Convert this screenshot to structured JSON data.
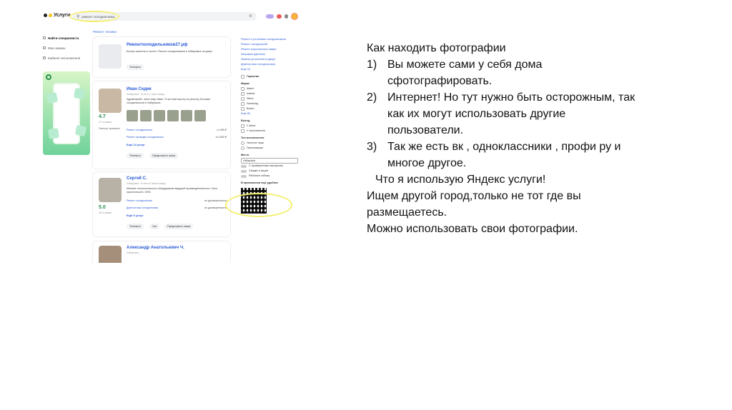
{
  "screenshot": {
    "brand": "Услуги",
    "search_value": "ремонт холодильника",
    "breadcrumb": "Ремонт техники",
    "sidebar": [
      {
        "label": "Найти специалиста",
        "active": true
      },
      {
        "label": "Мои заказы",
        "active": false
      },
      {
        "label": "Кабинет исполнителя",
        "active": false
      }
    ],
    "cards": [
      {
        "name": "Ремонтхолодильников27.рф",
        "desc": "Быстро качество и честно. Ремонт холодильников в Хабаровске на дому!",
        "buttons": [
          "Телефон"
        ]
      },
      {
        "name": "Иван Седик",
        "sub": "Хабаровск · В сети 2 часа назад",
        "desc": "Здравствуйте, меня зовут Иван. Я частный мастер по ремонту бытовых холодильников в Хабаровске.",
        "rating": "4.7",
        "reviews": "12 отзывов",
        "check": "Паспорт проверен",
        "prices": [
          {
            "service": "Ремонт холодильника",
            "price": "от 300 ₽"
          },
          {
            "service": "Ремонт проводки холодильника",
            "price": "от 1000 ₽"
          }
        ],
        "more_link": "Ещё 14 услуг",
        "buttons": [
          "Телефон",
          "Предложить заказ"
        ]
      },
      {
        "name": "Сергей С.",
        "sub": "Хабаровск · В сети 5 часов назад",
        "desc": "Меньше технологического оборудования ведущей производительности. Опыт практической с 2005.",
        "rating": "5.0",
        "reviews": "28 отзывов",
        "prices": [
          {
            "service": "Ремонт холодильника",
            "price": "по договоренности"
          },
          {
            "service": "Диагностика холодильника",
            "price": "по договоренности"
          }
        ],
        "more_link": "Ещё 9 услуг",
        "buttons": [
          "Телефон",
          "Чат",
          "Предложить заказ"
        ]
      },
      {
        "name": "Александр Анатольевич Ч.",
        "sub": "Хабаровск"
      }
    ],
    "filters": {
      "links": [
        "Ремонт и установка холодильников",
        "Ремонт холодильной",
        "Ремонт морозильных камер",
        "Заправка фреоном",
        "Замена уплотнителя двери",
        "Диагностика холодильника",
        "Ещё 10"
      ],
      "guarantee": "Гарантия",
      "brand_header": "Марка",
      "brands": [
        "Atlant",
        "Indesit",
        "Stinol",
        "Samsung",
        "Bosch"
      ],
      "brand_more": "Ещё 60",
      "visit_header": "Выезд",
      "visit": [
        "У меня",
        "У исполнителя"
      ],
      "type_header": "Тип исполнителя",
      "types": [
        "Частное лицо",
        "Организация"
      ],
      "place_header": "Место",
      "city_value": "Хабаровск",
      "toggles": [
        "С проверенным паспортом",
        "Скидки и акции",
        "Работает сейчас"
      ],
      "app_note": "В приложении ещё удобнее"
    }
  },
  "slide": {
    "heading": "Как находить фотографии",
    "items": [
      {
        "num": "1)",
        "lines": [
          "Вы можете сами у себя дома",
          "сфотографировать."
        ]
      },
      {
        "num": "2)",
        "lines": [
          "Интернет! Но тут нужно быть осторожным, так",
          "как их могут использовать другие",
          "пользователи."
        ]
      },
      {
        "num": "3)",
        "lines": [
          "Так же есть вк , одноклассники , профи ру и",
          "многое другое."
        ]
      }
    ],
    "line4": "Что я использую Яндекс услуги!",
    "line5": "Ищем другой город,только не тот где вы",
    "line6": "размещаетесь.",
    "line7": "Можно использовать свои фотографии."
  }
}
